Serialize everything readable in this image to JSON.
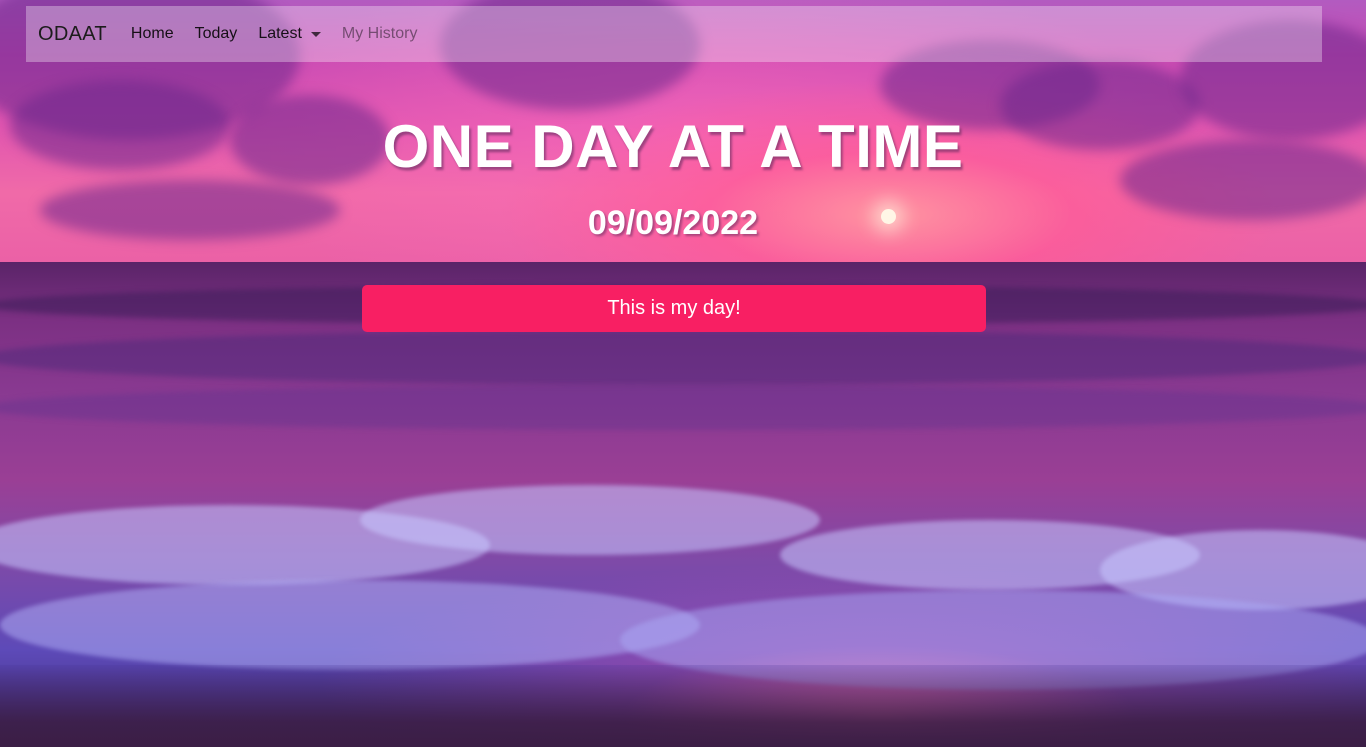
{
  "navbar": {
    "brand": "ODAAT",
    "items": [
      {
        "label": "Home",
        "state": "active"
      },
      {
        "label": "Today",
        "state": "normal"
      },
      {
        "label": "Latest",
        "state": "dropdown"
      },
      {
        "label": "My History",
        "state": "disabled"
      }
    ]
  },
  "hero": {
    "title": "ONE DAY AT A TIME",
    "date": "09/09/2022",
    "button_label": "This is my day!"
  },
  "colors": {
    "button": "#f81f63",
    "sky": "#e055b0",
    "sea": "#7e4aa8"
  },
  "icons": {
    "latest_dropdown": "caret-down-icon"
  }
}
